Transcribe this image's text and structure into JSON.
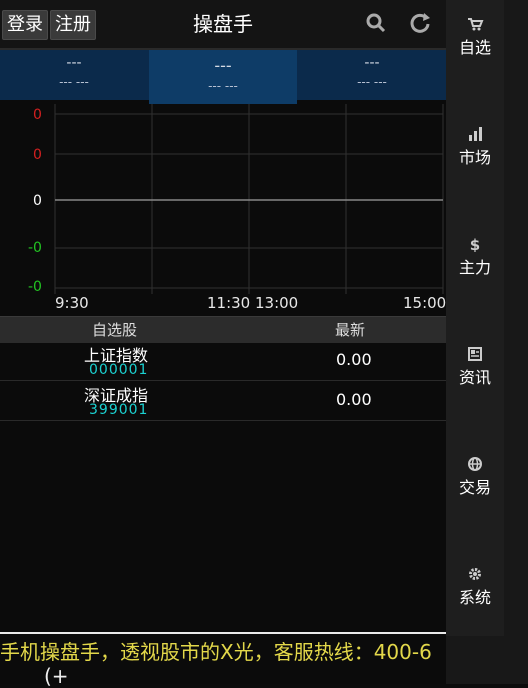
{
  "header": {
    "login": "登录",
    "register": "注册",
    "title": "操盘手"
  },
  "indices": [
    {
      "value": "---",
      "change": "--- ---"
    },
    {
      "value": "---",
      "change": "--- ---"
    },
    {
      "value": "---",
      "change": "--- ---"
    }
  ],
  "chart_data": {
    "type": "line",
    "y_tick_labels": [
      "0",
      "0",
      "0",
      "-0",
      "-0"
    ],
    "x_tick_labels": [
      "9:30",
      "11:30 13:00",
      "15:00"
    ],
    "series": [],
    "colors": {
      "up": "#d42020",
      "neutral": "#ffffff",
      "down": "#22c422"
    }
  },
  "list": {
    "headers": {
      "name": "自选股",
      "latest": "最新"
    },
    "rows": [
      {
        "name": "上证指数",
        "code": "000001",
        "price": "0.00"
      },
      {
        "name": "深证成指",
        "code": "399001",
        "price": "0.00"
      }
    ]
  },
  "ticker": "手机操盘手，透视股市的X光，客服热线：400-6",
  "bottom_text": "(+",
  "sidebar": [
    {
      "label": "自选",
      "icon": "cart-icon"
    },
    {
      "label": "市场",
      "icon": "bar-chart-icon"
    },
    {
      "label": "主力",
      "icon": "dollar-icon"
    },
    {
      "label": "资讯",
      "icon": "news-icon"
    },
    {
      "label": "交易",
      "icon": "globe-icon"
    },
    {
      "label": "系统",
      "icon": "gear-icon"
    }
  ]
}
